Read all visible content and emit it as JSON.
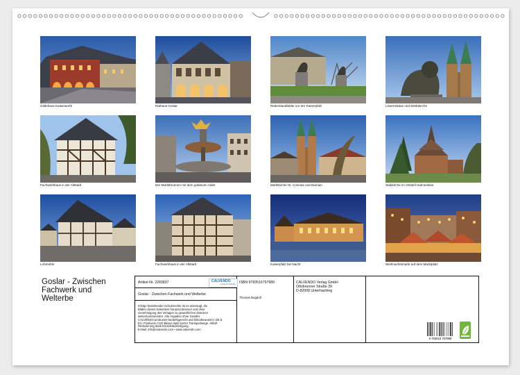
{
  "photos": [
    {
      "caption": "Gildehaus Kaiserworth",
      "theme": "guildhall"
    },
    {
      "caption": "Rathaus Goslar",
      "theme": "townhall"
    },
    {
      "caption": "Reiterstandbilder vor der Kaiserpfalz",
      "theme": "statues"
    },
    {
      "caption": "Löwenstatue und Marktkirche",
      "theme": "lion"
    },
    {
      "caption": "Fachwerkhaus in der Altstadt",
      "theme": "halftimber"
    },
    {
      "caption": "Der Marktbrunnen mit dem goldenen Adler",
      "theme": "fountain"
    },
    {
      "caption": "Marktkirche St. Cosmas und Damian",
      "theme": "church"
    },
    {
      "caption": "Stabkirche im Ortsteil Hahnenklee",
      "theme": "stave"
    },
    {
      "caption": "Lohmühle",
      "theme": "mill"
    },
    {
      "caption": "Fachwerkhaus in der Altstadt",
      "theme": "halftimber2"
    },
    {
      "caption": "Kaiserpfalz bei Nacht",
      "theme": "palace"
    },
    {
      "caption": "Weihnachtsmarkt auf dem Marktplatz",
      "theme": "market"
    }
  ],
  "title_lines": [
    "Goslar - Zwischen",
    "Fachwerk und",
    "Welterbe"
  ],
  "info": {
    "article": "Artikel-Nr. 2283837",
    "calvendo_logo": "CALVENDO",
    "calvendo_logo_sub": "verlag für kalender",
    "product_title": "Goslar - Zwischen Fachwerk und Welterbe",
    "legal_lines": [
      "Infolge bestehender Schutzrechte ist es untersagt, die",
      "Blätter dieses Kalenders herauszutrennen und ohne",
      "Genehmigung des Verlages zu gewerblichen Zwecken",
      "weiterzuverwenden. Alle Angaben ohne Gewähr.",
      "CALVENDO produziert bedarfsgerecht und klimabewusst in DE &",
      "EU. Positivere CO2-Bilanz dank kurzer Transportwege. Abfall-",
      "Reduzierung dank Einzelstückfertigung.",
      "E-Mail: info@calvendo.com • www.calvendo.com"
    ],
    "isbn": "ISBN 9783516757989",
    "author": "Thomas Bugdoll",
    "publisher_lines": [
      "CALVENDO Verlag GmbH",
      "Ottobrunner Straße 39",
      "D-82008 Unterhaching"
    ],
    "barcode_number": "9 783516 757989"
  },
  "colors": {
    "frame_border": "#111111",
    "eco_badge": "#71b83a",
    "logo_blue": "#1e6fb3"
  }
}
